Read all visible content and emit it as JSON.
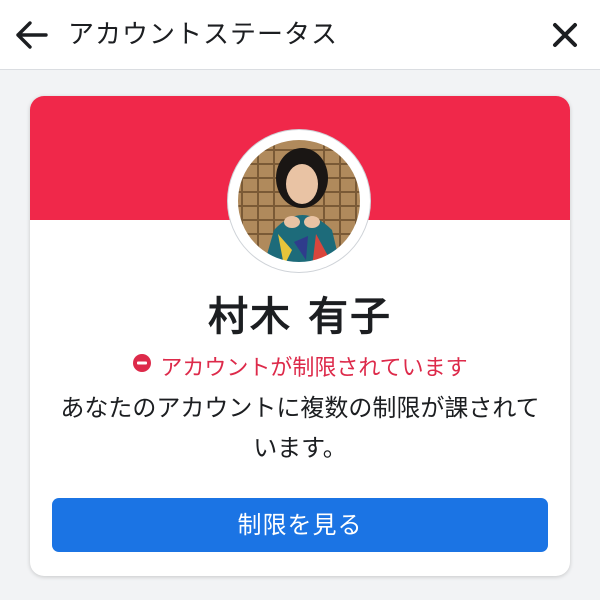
{
  "header": {
    "title": "アカウントステータス",
    "back_icon": "arrow-left-icon",
    "close_icon": "close-icon"
  },
  "profile": {
    "name": "村木 有子",
    "cover_color": "#f0284a"
  },
  "status": {
    "icon": "restricted-icon",
    "text": "アカウントが制限されています",
    "color": "#dd2a4a"
  },
  "description": "あなたのアカウントに複数の制限が課されています。",
  "actions": {
    "view_restrictions_label": "制限を見る",
    "button_color": "#1b74e4"
  }
}
